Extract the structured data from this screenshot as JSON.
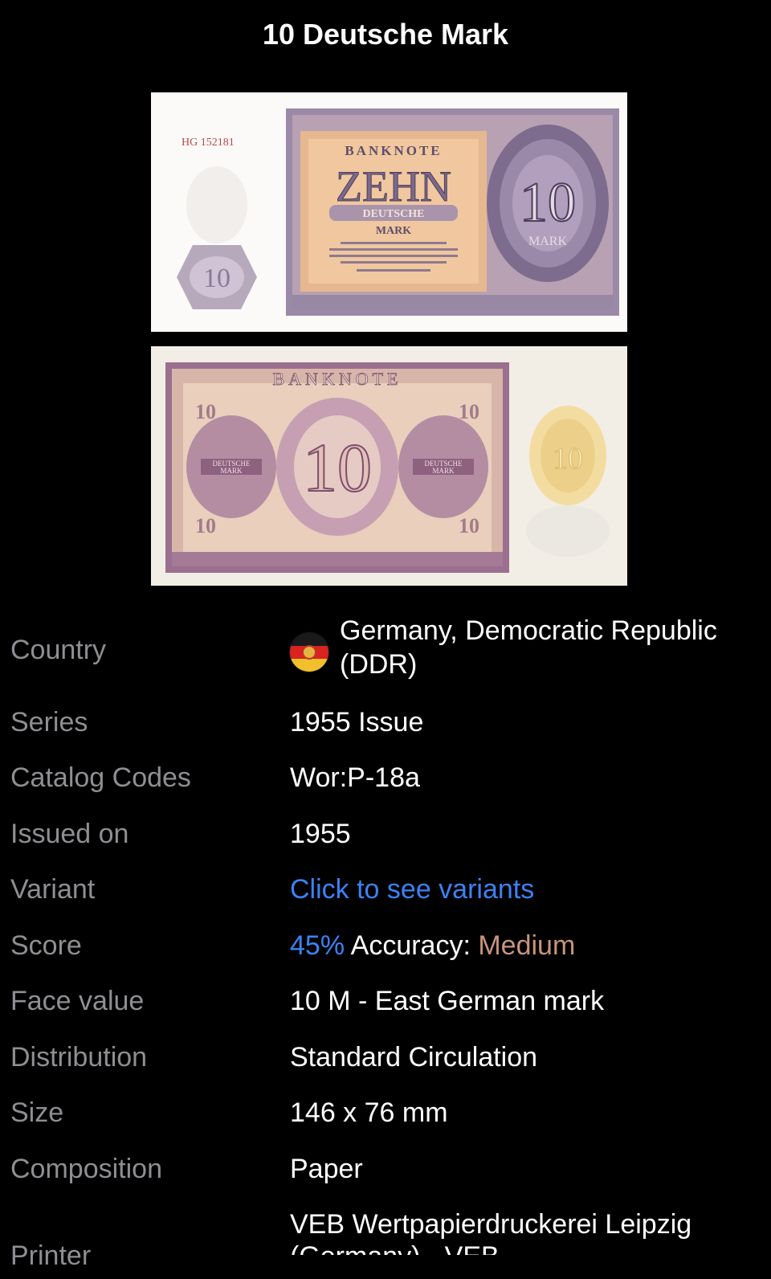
{
  "page_title": "10 Deutsche Mark",
  "banknote": {
    "front": {
      "serial": "HG 152181",
      "word_banknote": "BANKNOTE",
      "word_amount": "ZEHN",
      "word_deutsche": "DEUTSCHE",
      "word_mark": "MARK",
      "numeral": "10",
      "numeral_label": "MARK",
      "small_numeral": "10"
    },
    "back": {
      "word_banknote": "BANKNOTE",
      "numeral": "10",
      "corner_numeral": "10",
      "side_text_1": "DEUTSCHE",
      "side_text_2": "MARK",
      "watermark_numeral": "10"
    }
  },
  "details": {
    "country": {
      "label": "Country",
      "value": "Germany, Democratic Republic (DDR)",
      "flag_icon": "ddr-flag-icon"
    },
    "series": {
      "label": "Series",
      "value": "1955 Issue"
    },
    "catalog_codes": {
      "label": "Catalog Codes",
      "value": "Wor:P-18a"
    },
    "issued_on": {
      "label": "Issued on",
      "value": "1955"
    },
    "variant": {
      "label": "Variant",
      "value": "Click to see variants"
    },
    "score": {
      "label": "Score",
      "percent": "45%",
      "accuracy_label": "Accuracy:",
      "accuracy_value": "Medium",
      "percent_color": "#3b82f6",
      "accuracy_color": "#c8957a"
    },
    "face_value": {
      "label": "Face value",
      "value": "10 M - East German mark"
    },
    "distribution": {
      "label": "Distribution",
      "value": "Standard Circulation"
    },
    "size": {
      "label": "Size",
      "value": "146 x 76 mm"
    },
    "composition": {
      "label": "Composition",
      "value": "Paper"
    },
    "printer": {
      "label": "Printer",
      "value": "VEB Wertpapierdruckerei Leipzig (Germany) - VEB"
    }
  },
  "colors": {
    "background": "#000000",
    "label": "#8e8e93",
    "value": "#ffffff",
    "link": "#3b82f6"
  }
}
